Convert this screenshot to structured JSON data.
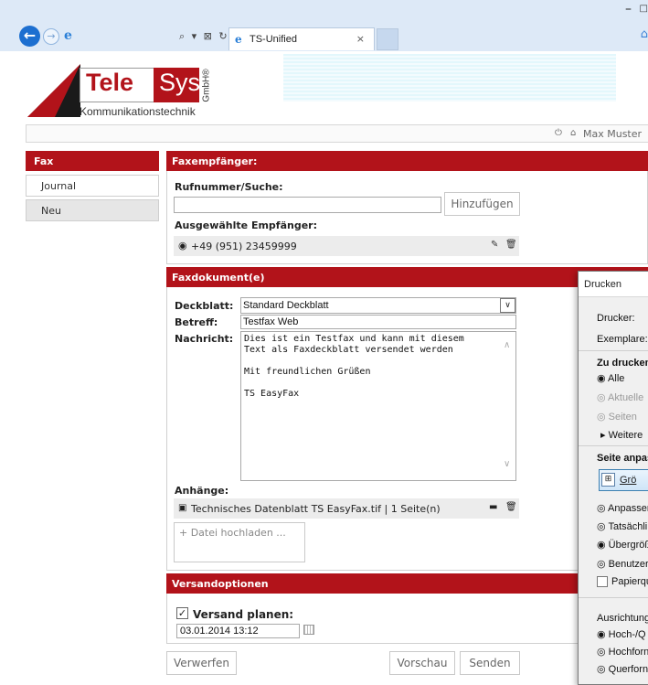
{
  "browser": {
    "tab_title": "TS-Unified",
    "tab_close": "×",
    "back_glyph": "←",
    "fwd_glyph": "→",
    "ie_glyph": "e",
    "address_tools": "⌕ ▾ ⊠ ↻",
    "win_min": "–",
    "win_max": "□",
    "home_glyph": "⌂",
    "icons": [
      "back-arrow-icon",
      "forward-arrow-icon",
      "ie-logo-icon",
      "search-icon",
      "refresh-icon",
      "home-icon"
    ]
  },
  "header": {
    "logo_tele": "Tele",
    "logo_sys": "Sys",
    "logo_gmbh": "GmbH®",
    "logo_sub": "Kommunikationstechnik",
    "brand_color": "#b2131a"
  },
  "userbar": {
    "logout_glyph": "⏻",
    "home_glyph": "⌂",
    "user_name": "Max Muster"
  },
  "sidebar": {
    "title": "Fax",
    "items": [
      {
        "label": "Journal",
        "active": false
      },
      {
        "label": "Neu",
        "active": true
      }
    ]
  },
  "recipients_panel": {
    "title": "Faxempfänger:",
    "search_label": "Rufnummer/Suche:",
    "search_value": "",
    "add_button": "Hinzufügen",
    "selected_label": "Ausgewählte Empfänger:",
    "selected": [
      {
        "radio": "◉",
        "number": "+49 (951) 23459999",
        "edit_glyph": "✎",
        "delete_glyph": "🗑"
      }
    ]
  },
  "document_panel": {
    "title": "Faxdokument(e)",
    "cover_label": "Deckblatt:",
    "cover_value": "Standard Deckblatt",
    "cover_arrow": "∨",
    "subject_label": "Betreff:",
    "subject_value": "Testfax Web",
    "message_label": "Nachricht:",
    "message_value": "Dies ist ein Testfax und kann mit diesem\nText als Faxdeckblatt versendet werden\n\nMit freundlichen Grüßen\n\nTS EasyFax",
    "scroll_up": "∧",
    "scroll_down": "∨",
    "attachments_label": "Anhänge:",
    "attachments": [
      {
        "icon": "▣",
        "name": "Technisches Datenblatt TS EasyFax.tif | 1 Seite(n)",
        "folder_glyph": "▬",
        "delete_glyph": "🗑"
      }
    ],
    "upload_label": "+ Datei hochladen ..."
  },
  "options_panel": {
    "title": "Versandoptionen",
    "schedule_checked": true,
    "check_glyph": "✓",
    "schedule_label": "Versand planen:",
    "schedule_value": "03.01.2014 13:12"
  },
  "actions": {
    "discard": "Verwerfen",
    "preview": "Vorschau",
    "send": "Senden"
  },
  "print_dialog": {
    "title": "Drucken",
    "printer_label": "Drucker:",
    "copies_label": "Exemplare:",
    "print_range_title": "Zu drucken",
    "opt_all": "◉ Alle",
    "opt_current": "◎ Aktuelle",
    "opt_pages": "◎ Seiten",
    "more": "▸ Weitere",
    "fit_title": "Seite anpas",
    "size_button": "Grö",
    "size_icon": "⊞",
    "opt_fit": "◎ Anpassen",
    "opt_actual": "◎ Tatsächli",
    "opt_oversize": "◉ Übergröß",
    "opt_custom": "◎ Benutzer",
    "paper_source": "Papierqu",
    "orientation_title": "Ausrichtung",
    "opt_auto": "◉ Hoch-/Q",
    "opt_portrait": "◎ Hochforn",
    "opt_landscape": "◎ Querforn"
  }
}
